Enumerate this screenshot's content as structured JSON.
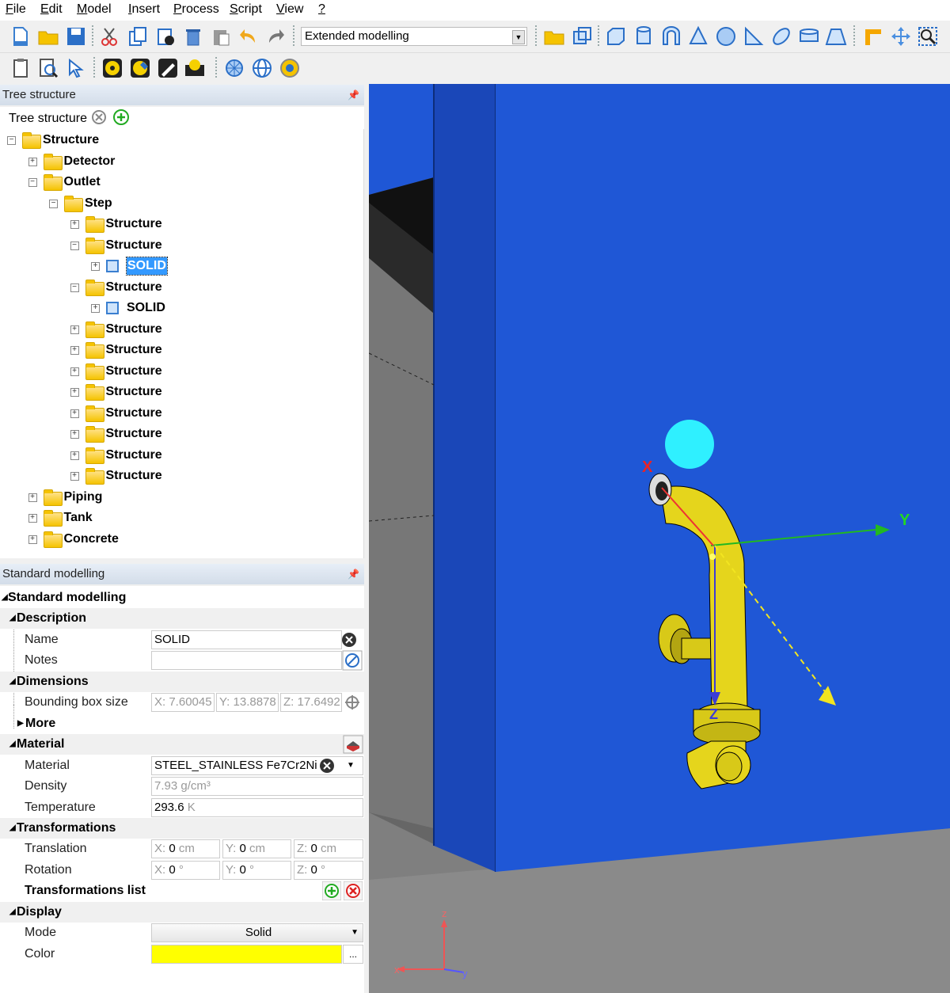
{
  "menu": [
    "File",
    "Edit",
    "Model",
    "Insert",
    "Process",
    "Script",
    "View",
    "?"
  ],
  "toolbar": {
    "mode": "Extended modelling"
  },
  "tree_panel": {
    "header": "Tree structure",
    "label": "Tree structure",
    "nodes": [
      {
        "label": "Structure",
        "depth": 0,
        "exp": "−",
        "icon": "folder"
      },
      {
        "label": "Detector",
        "depth": 1,
        "exp": "+",
        "icon": "folder"
      },
      {
        "label": "Outlet",
        "depth": 1,
        "exp": "−",
        "icon": "folder"
      },
      {
        "label": "Step",
        "depth": 2,
        "exp": "−",
        "icon": "folder"
      },
      {
        "label": "Structure",
        "depth": 3,
        "exp": "+",
        "icon": "folder"
      },
      {
        "label": "Structure",
        "depth": 3,
        "exp": "−",
        "icon": "folder"
      },
      {
        "label": "SOLID",
        "depth": 4,
        "exp": "+",
        "icon": "cube",
        "selected": true
      },
      {
        "label": "Structure",
        "depth": 3,
        "exp": "−",
        "icon": "folder"
      },
      {
        "label": "SOLID",
        "depth": 4,
        "exp": "+",
        "icon": "cube"
      },
      {
        "label": "Structure",
        "depth": 3,
        "exp": "+",
        "icon": "folder"
      },
      {
        "label": "Structure",
        "depth": 3,
        "exp": "+",
        "icon": "folder"
      },
      {
        "label": "Structure",
        "depth": 3,
        "exp": "+",
        "icon": "folder"
      },
      {
        "label": "Structure",
        "depth": 3,
        "exp": "+",
        "icon": "folder"
      },
      {
        "label": "Structure",
        "depth": 3,
        "exp": "+",
        "icon": "folder"
      },
      {
        "label": "Structure",
        "depth": 3,
        "exp": "+",
        "icon": "folder"
      },
      {
        "label": "Structure",
        "depth": 3,
        "exp": "+",
        "icon": "folder"
      },
      {
        "label": "Structure",
        "depth": 3,
        "exp": "+",
        "icon": "folder"
      },
      {
        "label": "Piping",
        "depth": 1,
        "exp": "+",
        "icon": "folder"
      },
      {
        "label": "Tank",
        "depth": 1,
        "exp": "+",
        "icon": "folder"
      },
      {
        "label": "Concrete",
        "depth": 1,
        "exp": "+",
        "icon": "folder"
      }
    ]
  },
  "props": {
    "header": "Standard modelling",
    "title": "Standard modelling",
    "description": {
      "label": "Description",
      "name_label": "Name",
      "name_value": "SOLID",
      "notes_label": "Notes",
      "notes_value": ""
    },
    "dimensions": {
      "label": "Dimensions",
      "bbox_label": "Bounding box size",
      "bbox_x": "X: 7.60045",
      "bbox_y": "Y: 13.8878",
      "bbox_z": "Z: 17.6492",
      "more_label": "More"
    },
    "material": {
      "label": "Material",
      "mat_label": "Material",
      "mat_value": "STEEL_STAINLESS Fe7Cr2Ni",
      "density_label": "Density",
      "density_value": "7.93 g/cm³",
      "temp_label": "Temperature",
      "temp_value": "293.6",
      "temp_unit": "K"
    },
    "transformations": {
      "label": "Transformations",
      "trans_label": "Translation",
      "rot_label": "Rotation",
      "tx": "0",
      "ty": "0",
      "tz": "0",
      "cm": "cm",
      "rx": "0",
      "ry": "0",
      "rz": "0",
      "deg": "°",
      "list_label": "Transformations list"
    },
    "display": {
      "label": "Display",
      "mode_label": "Mode",
      "mode_value": "Solid",
      "color_label": "Color",
      "color_value": "#ffff00",
      "color_btn": "..."
    }
  },
  "viewport": {
    "axis_y": "Y",
    "axis_z": "Z",
    "axis_x": "X",
    "mini_z": "z",
    "mini_x": "x",
    "mini_y": "y"
  },
  "colors": {
    "background_blue": "#1f57d6",
    "pipe": "#e5d51c",
    "selection": "#3399ff",
    "sphere": "#2ff0ff"
  }
}
